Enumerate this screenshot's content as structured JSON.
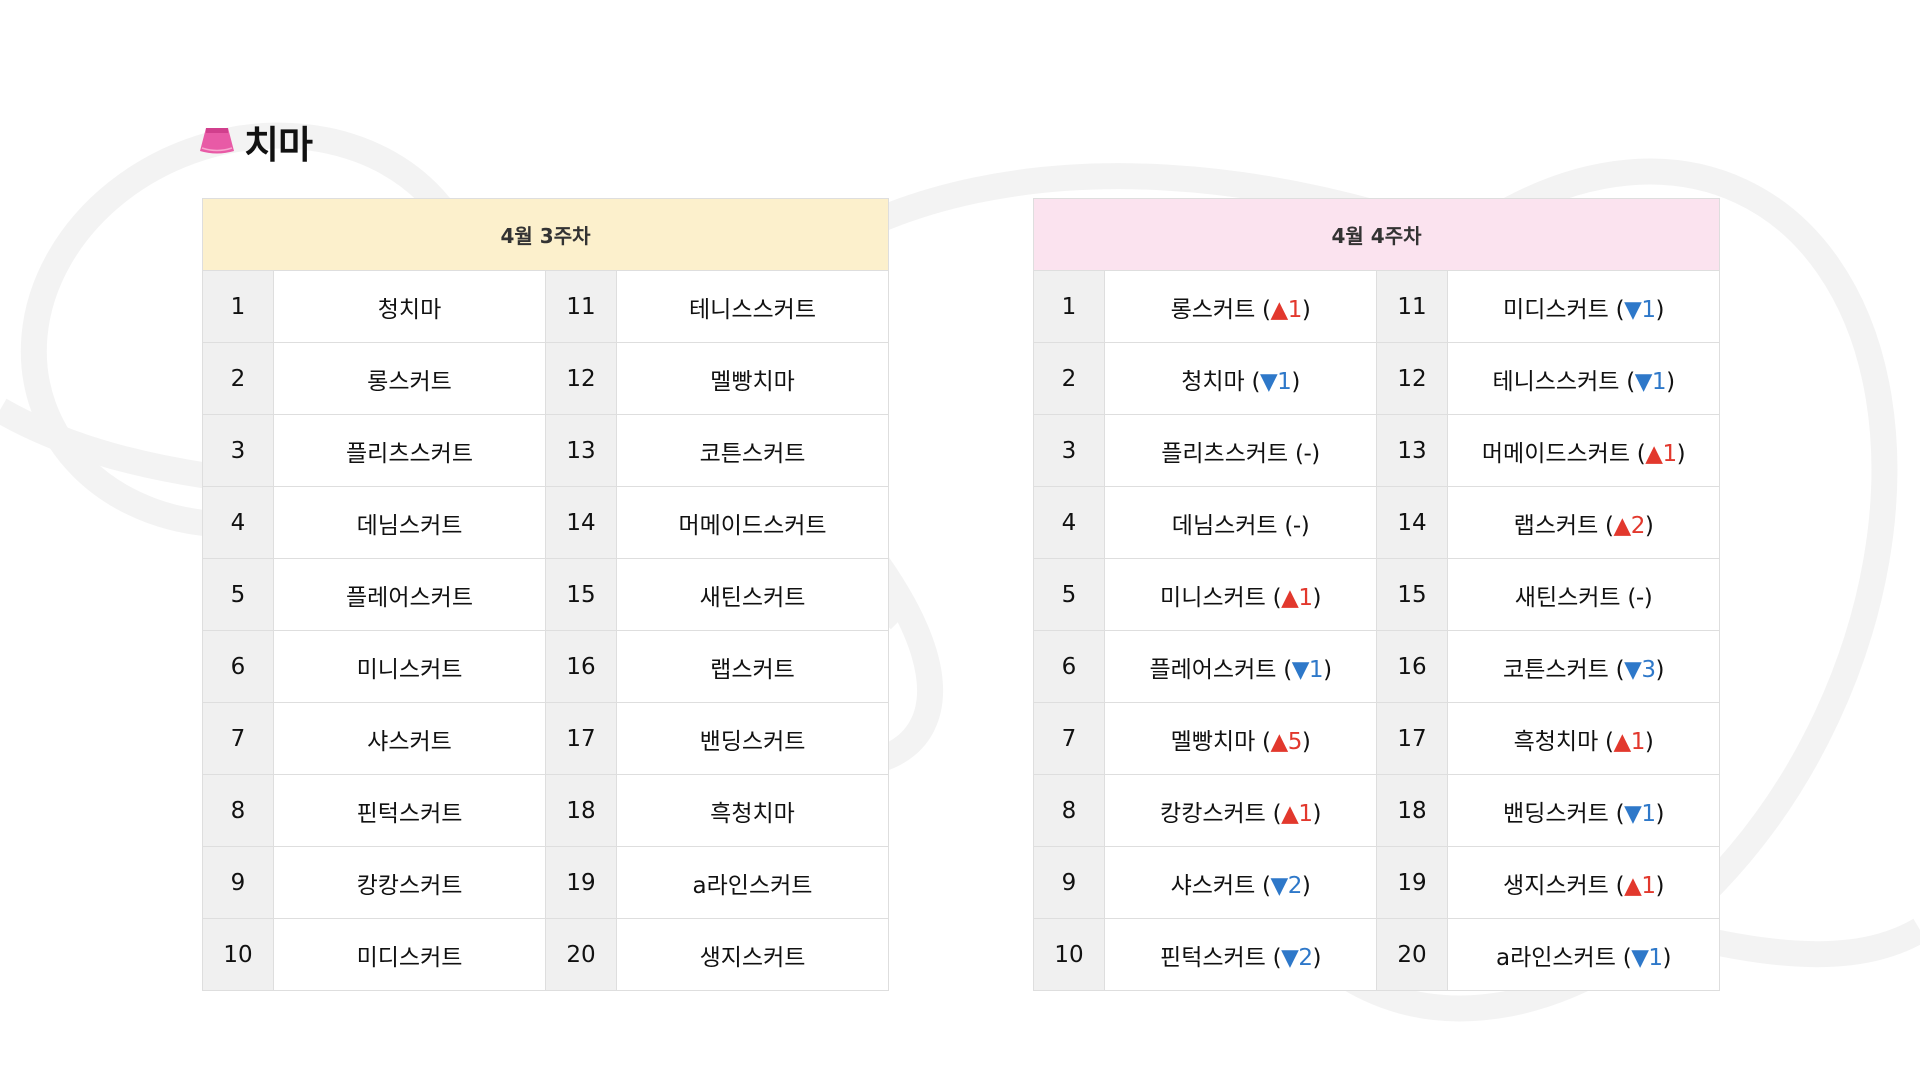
{
  "title": "치마",
  "colors": {
    "up": "#e2382d",
    "down": "#2e78c9",
    "left_header_bg": "#fcf0cc",
    "right_header_bg": "#fbe3ef",
    "icon": "#e85aa6"
  },
  "icons": {
    "title": "skirt-icon",
    "up": "triangle-up",
    "down": "triangle-down"
  },
  "left_table": {
    "header": "4월 3주차",
    "rows": [
      {
        "left_rank": "1",
        "left_name": "청치마",
        "right_rank": "11",
        "right_name": "테니스스커트"
      },
      {
        "left_rank": "2",
        "left_name": "롱스커트",
        "right_rank": "12",
        "right_name": "멜빵치마"
      },
      {
        "left_rank": "3",
        "left_name": "플리츠스커트",
        "right_rank": "13",
        "right_name": "코튼스커트"
      },
      {
        "left_rank": "4",
        "left_name": "데님스커트",
        "right_rank": "14",
        "right_name": "머메이드스커트"
      },
      {
        "left_rank": "5",
        "left_name": "플레어스커트",
        "right_rank": "15",
        "right_name": "새틴스커트"
      },
      {
        "left_rank": "6",
        "left_name": "미니스커트",
        "right_rank": "16",
        "right_name": "랩스커트"
      },
      {
        "left_rank": "7",
        "left_name": "샤스커트",
        "right_rank": "17",
        "right_name": "밴딩스커트"
      },
      {
        "left_rank": "8",
        "left_name": "핀턱스커트",
        "right_rank": "18",
        "right_name": "흑청치마"
      },
      {
        "left_rank": "9",
        "left_name": "캉캉스커트",
        "right_rank": "19",
        "right_name": "a라인스커트"
      },
      {
        "left_rank": "10",
        "left_name": "미디스커트",
        "right_rank": "20",
        "right_name": "생지스커트"
      }
    ]
  },
  "right_table": {
    "header": "4월 4주차",
    "rows": [
      {
        "left_rank": "1",
        "left_name": "롱스커트",
        "left_change": {
          "dir": "up",
          "text": "1"
        },
        "right_rank": "11",
        "right_name": "미디스커트",
        "right_change": {
          "dir": "down",
          "text": "1"
        }
      },
      {
        "left_rank": "2",
        "left_name": "청치마",
        "left_change": {
          "dir": "down",
          "text": "1"
        },
        "right_rank": "12",
        "right_name": "테니스스커트",
        "right_change": {
          "dir": "down",
          "text": "1"
        }
      },
      {
        "left_rank": "3",
        "left_name": "플리츠스커트",
        "left_change": {
          "dir": "same",
          "text": "-"
        },
        "right_rank": "13",
        "right_name": "머메이드스커트",
        "right_change": {
          "dir": "up",
          "text": "1"
        }
      },
      {
        "left_rank": "4",
        "left_name": "데님스커트",
        "left_change": {
          "dir": "same",
          "text": "-"
        },
        "right_rank": "14",
        "right_name": "랩스커트",
        "right_change": {
          "dir": "up",
          "text": "2"
        }
      },
      {
        "left_rank": "5",
        "left_name": "미니스커트",
        "left_change": {
          "dir": "up",
          "text": "1"
        },
        "right_rank": "15",
        "right_name": "새틴스커트",
        "right_change": {
          "dir": "same",
          "text": "-"
        }
      },
      {
        "left_rank": "6",
        "left_name": "플레어스커트",
        "left_change": {
          "dir": "down",
          "text": "1"
        },
        "right_rank": "16",
        "right_name": "코튼스커트",
        "right_change": {
          "dir": "down",
          "text": "3"
        }
      },
      {
        "left_rank": "7",
        "left_name": "멜빵치마",
        "left_change": {
          "dir": "up",
          "text": "5"
        },
        "right_rank": "17",
        "right_name": "흑청치마",
        "right_change": {
          "dir": "up",
          "text": "1"
        }
      },
      {
        "left_rank": "8",
        "left_name": "캉캉스커트",
        "left_change": {
          "dir": "up",
          "text": "1"
        },
        "right_rank": "18",
        "right_name": "밴딩스커트",
        "right_change": {
          "dir": "down",
          "text": "1"
        }
      },
      {
        "left_rank": "9",
        "left_name": "샤스커트",
        "left_change": {
          "dir": "down",
          "text": "2"
        },
        "right_rank": "19",
        "right_name": "생지스커트",
        "right_change": {
          "dir": "up",
          "text": "1"
        }
      },
      {
        "left_rank": "10",
        "left_name": "핀턱스커트",
        "left_change": {
          "dir": "down",
          "text": "2"
        },
        "right_rank": "20",
        "right_name": "a라인스커트",
        "right_change": {
          "dir": "down",
          "text": "1"
        }
      }
    ]
  }
}
